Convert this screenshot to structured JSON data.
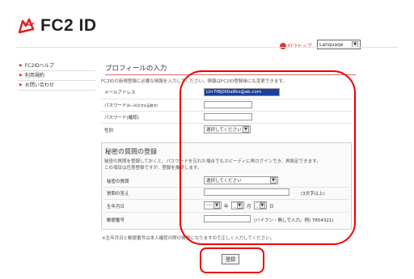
{
  "header": {
    "logo_text": "FC2 ID",
    "fc2top_label": "FC2トップ",
    "language_select": "Language"
  },
  "sidebar": {
    "items": [
      {
        "label": "FC2IDヘルプ"
      },
      {
        "label": "利用規約"
      },
      {
        "label": "お問い合わせ"
      }
    ]
  },
  "profile": {
    "title": "プロフィールの入力",
    "description": "FC2IDの新規登録に必要な情報を入力してください。情報はFC2ID登録後にも変更できます。",
    "email_label": "メールアドレス",
    "email_value": "Lhr7f8j0ll0a8ks@ab.com",
    "password_label": "パスワード",
    "password_note": "(8〜16文字の英数字)",
    "password_confirm_label": "パスワード(確認)",
    "gender_label": "性別",
    "gender_select": "選択してください"
  },
  "secret": {
    "title": "秘密の質問の登録",
    "description1": "秘密の質問を登録しておくと、パスワードを忘れた場合でもスピーディに再ログインでき、再設定できます。",
    "description2": "この項目は任意登録ですが、登録を推奨します。",
    "question_label": "秘密の質問",
    "question_select": "選択してください",
    "answer_label": "質問の答え",
    "answer_hint": "(3文字以上)",
    "birthdate_label": "生年月日",
    "year_select": "----",
    "year_unit": "年",
    "month_select": "--",
    "month_unit": "月",
    "day_select": "--",
    "day_unit": "日",
    "postal_label": "郵便番号",
    "postal_hint": "(ハイフン・無しで入力。例) 7654321)",
    "footnote": "※生年月日と郵便番号は本人確認の際の情報になりますので正しく入力してください。"
  },
  "actions": {
    "register_label": "登録"
  },
  "colors": {
    "accent": "#e00000",
    "title_underline": "#e06a6a"
  }
}
